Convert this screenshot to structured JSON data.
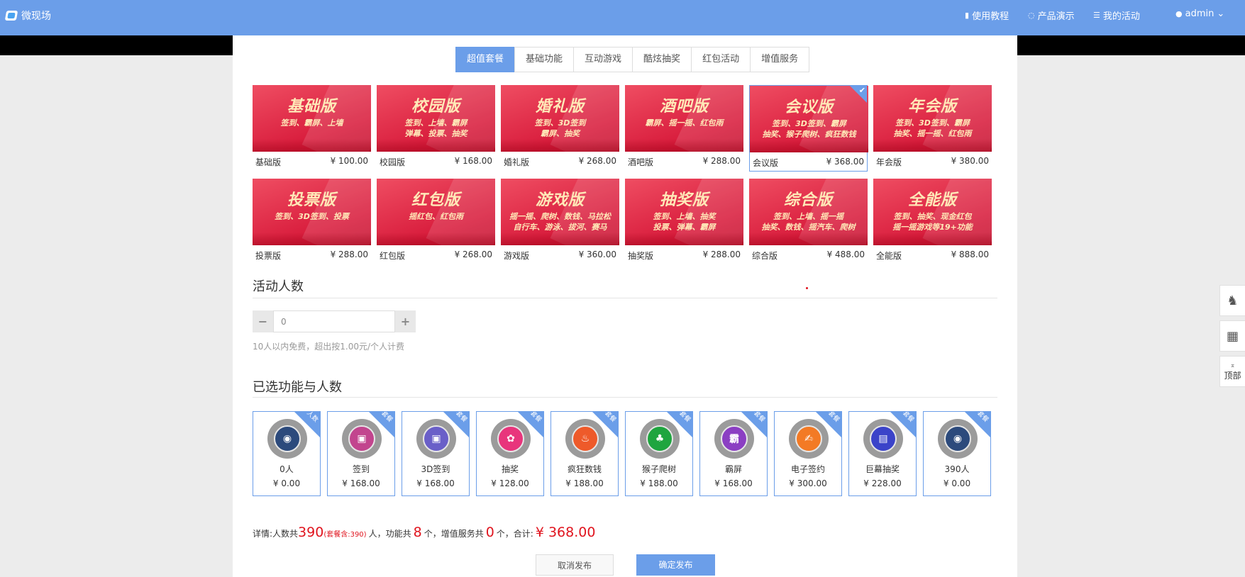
{
  "header": {
    "brand": "微现场",
    "nav": [
      {
        "icon": "book-icon",
        "glyph": "▮",
        "label": "使用教程"
      },
      {
        "icon": "chat-icon",
        "glyph": "◌",
        "label": "产品演示"
      },
      {
        "icon": "list-icon",
        "glyph": "☰",
        "label": "我的活动"
      },
      {
        "icon": "user-icon",
        "glyph": "●",
        "label": "admin"
      }
    ],
    "chevron": "⌄"
  },
  "tabs": [
    {
      "label": "超值套餐",
      "active": true
    },
    {
      "label": "基础功能",
      "active": false
    },
    {
      "label": "互动游戏",
      "active": false
    },
    {
      "label": "酷炫抽奖",
      "active": false
    },
    {
      "label": "红包活动",
      "active": false
    },
    {
      "label": "增值服务",
      "active": false
    }
  ],
  "packages": [
    {
      "title": "基础版",
      "subtitle": "签到、霸屏、上墙",
      "name": "基础版",
      "price": "¥ 100.00",
      "selected": false
    },
    {
      "title": "校园版",
      "subtitle": "签到、上墙、霸屏\n弹幕、投票、抽奖",
      "name": "校园版",
      "price": "¥ 168.00",
      "selected": false
    },
    {
      "title": "婚礼版",
      "subtitle": "签到、3D签到\n霸屏、抽奖",
      "name": "婚礼版",
      "price": "¥ 268.00",
      "selected": false
    },
    {
      "title": "酒吧版",
      "subtitle": "霸屏、摇一摇、红包雨",
      "name": "酒吧版",
      "price": "¥ 288.00",
      "selected": false
    },
    {
      "title": "会议版",
      "subtitle": "签到、3D签到、霸屏\n抽奖、猴子爬树、疯狂数钱",
      "name": "会议版",
      "price": "¥ 368.00",
      "selected": true
    },
    {
      "title": "年会版",
      "subtitle": "签到、3D签到、霸屏\n抽奖、摇一摇、红包雨",
      "name": "年会版",
      "price": "¥ 380.00",
      "selected": false
    },
    {
      "title": "投票版",
      "subtitle": "签到、3D签到、投票",
      "name": "投票版",
      "price": "¥ 288.00",
      "selected": false
    },
    {
      "title": "红包版",
      "subtitle": "摇红包、红包雨",
      "name": "红包版",
      "price": "¥ 268.00",
      "selected": false
    },
    {
      "title": "游戏版",
      "subtitle": "摇一摇、爬树、数钱、马拉松\n自行车、游泳、拔河、赛马",
      "name": "游戏版",
      "price": "¥ 360.00",
      "selected": false
    },
    {
      "title": "抽奖版",
      "subtitle": "签到、上墙、抽奖\n投票、弹幕、霸屏",
      "name": "抽奖版",
      "price": "¥ 288.00",
      "selected": false
    },
    {
      "title": "综合版",
      "subtitle": "签到、上墙、摇一摇\n抽奖、数钱、摇汽车、爬树",
      "name": "综合版",
      "price": "¥ 488.00",
      "selected": false
    },
    {
      "title": "全能版",
      "subtitle": "签到、抽奖、现金红包\n摇一摇游戏等19+功能",
      "name": "全能版",
      "price": "¥ 888.00",
      "selected": false
    }
  ],
  "participants": {
    "title": "活动人数",
    "minus": "−",
    "plus": "+",
    "value": "0",
    "hint": "10人以内免费，超出按1.00元/个人计费"
  },
  "selected": {
    "title": "已选功能与人数",
    "items": [
      {
        "name": "0人",
        "price": "¥ 0.00",
        "corner": "人数",
        "color": "#2c4a7c",
        "icon": "person-icon",
        "glyph": "◉"
      },
      {
        "name": "签到",
        "price": "¥ 168.00",
        "corner": "套餐",
        "color": "#c2458e",
        "icon": "checkin-icon",
        "glyph": "▣"
      },
      {
        "name": "3D签到",
        "price": "¥ 168.00",
        "corner": "套餐",
        "color": "#6a5fc8",
        "icon": "checkin-3d-icon",
        "glyph": "▣"
      },
      {
        "name": "抽奖",
        "price": "¥ 128.00",
        "corner": "套餐",
        "color": "#e8357c",
        "icon": "lottery-icon",
        "glyph": "✿"
      },
      {
        "name": "疯狂数钱",
        "price": "¥ 188.00",
        "corner": "套餐",
        "color": "#ee5a2a",
        "icon": "money-icon",
        "glyph": "♨"
      },
      {
        "name": "猴子爬树",
        "price": "¥ 188.00",
        "corner": "套餐",
        "color": "#1fa53f",
        "icon": "monkey-icon",
        "glyph": "♣"
      },
      {
        "name": "霸屏",
        "price": "¥ 168.00",
        "corner": "套餐",
        "color": "#8b3fc3",
        "icon": "screen-icon",
        "glyph": "霸"
      },
      {
        "name": "电子签约",
        "price": "¥ 300.00",
        "corner": "套餐",
        "color": "#f37a25",
        "icon": "contract-icon",
        "glyph": "✍"
      },
      {
        "name": "巨幕抽奖",
        "price": "¥ 228.00",
        "corner": "套餐",
        "color": "#3b43c9",
        "icon": "big-screen-icon",
        "glyph": "▤"
      },
      {
        "name": "390人",
        "price": "¥ 0.00",
        "corner": "套餐",
        "color": "#2c4a7c",
        "icon": "person-icon",
        "glyph": "◉"
      }
    ]
  },
  "summary": {
    "prefix": "详情:人数共",
    "people": "390",
    "package_people": "(套餐含:390)",
    "after_people": "人，功能共",
    "features": "8",
    "after_features": "个，增值服务共",
    "services": "0",
    "after_services": "个，合计:",
    "total": "¥ 368.00"
  },
  "buttons": {
    "cancel": "取消发布",
    "confirm": "确定发布"
  },
  "float_tools": {
    "qq_glyph": "♞",
    "qr_glyph": "▦",
    "top_arrow": "⌅",
    "top_label": "顶部"
  },
  "colors": {
    "accent": "#6b9ee9",
    "price_red": "#e0141e",
    "card_red": "#d81c3c"
  }
}
